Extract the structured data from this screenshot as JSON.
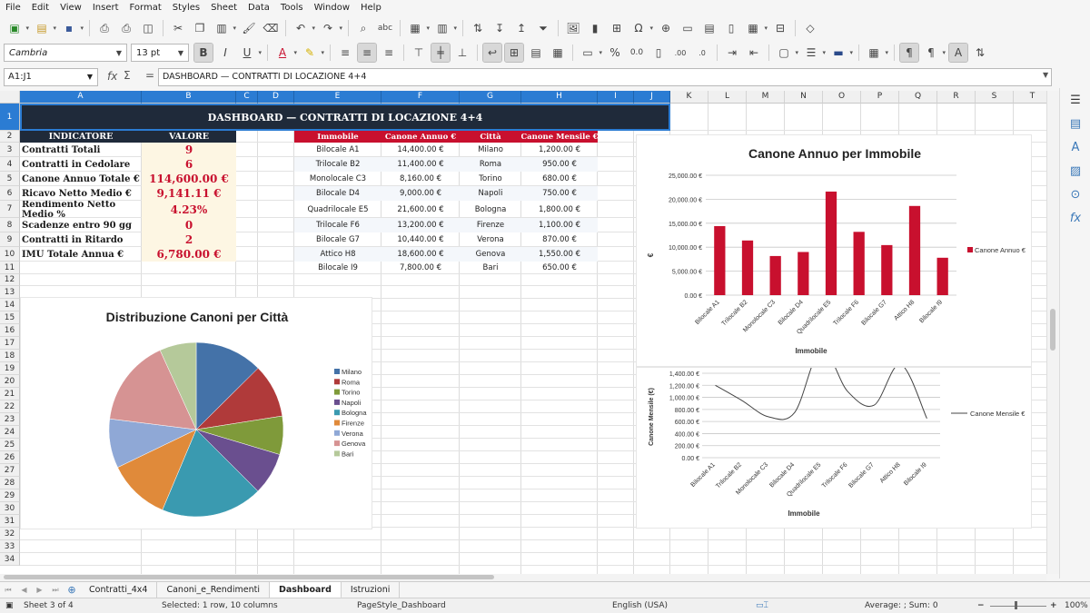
{
  "menu": [
    "File",
    "Edit",
    "View",
    "Insert",
    "Format",
    "Styles",
    "Sheet",
    "Data",
    "Tools",
    "Window",
    "Help"
  ],
  "toolbar": {
    "font_name": "Cambria",
    "font_size": "13 pt"
  },
  "formula_bar": {
    "name_box": "A1:J1",
    "content": "DASHBOARD — CONTRATTI DI LOCAZIONE 4+4"
  },
  "columns": [
    "A",
    "B",
    "C",
    "D",
    "E",
    "F",
    "G",
    "H",
    "I",
    "J",
    "K",
    "L",
    "M",
    "N",
    "O",
    "P",
    "Q",
    "R",
    "S",
    "T"
  ],
  "rows": [
    "1",
    "2",
    "3",
    "4",
    "5",
    "6",
    "7",
    "8",
    "9",
    "10",
    "11",
    "12",
    "13",
    "14",
    "15",
    "16",
    "17",
    "18",
    "19",
    "20",
    "21",
    "22",
    "23",
    "24",
    "25",
    "26",
    "27",
    "28",
    "29",
    "30",
    "31",
    "32",
    "33",
    "34"
  ],
  "banner": "DASHBOARD — CONTRATTI DI LOCAZIONE 4+4",
  "kpi": {
    "header_label": "INDICATORE",
    "header_value": "VALORE",
    "items": [
      {
        "label": "Contratti Totali",
        "value": "9"
      },
      {
        "label": "Contratti in Cedolare",
        "value": "6"
      },
      {
        "label": "Canone Annuo Totale €",
        "value": "114,600.00 €"
      },
      {
        "label": "Ricavo Netto Medio €",
        "value": "9,141.11 €"
      },
      {
        "label": "Rendimento Netto Medio %",
        "value": "4.23%"
      },
      {
        "label": "Scadenze entro 90 gg",
        "value": "0"
      },
      {
        "label": "Contratti in Ritardo",
        "value": "2"
      },
      {
        "label": "IMU Totale Annua €",
        "value": "6,780.00 €"
      }
    ]
  },
  "table": {
    "headers": [
      "Immobile",
      "Canone Annuo €",
      "Città",
      "Canone Mensile €"
    ],
    "rows": [
      [
        "Bilocale A1",
        "14,400.00 €",
        "Milano",
        "1,200.00 €"
      ],
      [
        "Trilocale B2",
        "11,400.00 €",
        "Roma",
        "950.00 €"
      ],
      [
        "Monolocale C3",
        "8,160.00 €",
        "Torino",
        "680.00 €"
      ],
      [
        "Bilocale D4",
        "9,000.00 €",
        "Napoli",
        "750.00 €"
      ],
      [
        "Quadrilocale E5",
        "21,600.00 €",
        "Bologna",
        "1,800.00 €"
      ],
      [
        "Trilocale F6",
        "13,200.00 €",
        "Firenze",
        "1,100.00 €"
      ],
      [
        "Bilocale G7",
        "10,440.00 €",
        "Verona",
        "870.00 €"
      ],
      [
        "Attico H8",
        "18,600.00 €",
        "Genova",
        "1,550.00 €"
      ],
      [
        "Bilocale I9",
        "7,800.00 €",
        "Bari",
        "650.00 €"
      ]
    ]
  },
  "chart_data": [
    {
      "type": "pie",
      "title": "Distribuzione Canoni per Città",
      "categories": [
        "Milano",
        "Roma",
        "Torino",
        "Napoli",
        "Bologna",
        "Firenze",
        "Verona",
        "Genova",
        "Bari"
      ],
      "values": [
        14400,
        11400,
        8160,
        9000,
        21600,
        13200,
        10440,
        18600,
        7800
      ],
      "colors": [
        "#4472a8",
        "#b03a3a",
        "#7f9a3a",
        "#6a4f8f",
        "#3a9ab0",
        "#e08a3a",
        "#8fa8d6",
        "#d69393",
        "#b5c99a"
      ],
      "legend": "right"
    },
    {
      "type": "bar",
      "title": "Canone Annuo per Immobile",
      "categories": [
        "Bilocale A1",
        "Trilocale B2",
        "Monolocale C3",
        "Bilocale D4",
        "Quadrilocale E5",
        "Trilocale F6",
        "Bilocale G7",
        "Attico H8",
        "Bilocale I9"
      ],
      "series": [
        {
          "name": "Canone Annuo €",
          "values": [
            14400,
            11400,
            8160,
            9000,
            21600,
            13200,
            10440,
            18600,
            7800
          ],
          "color": "#c8102e"
        }
      ],
      "xlabel": "Immobile",
      "ylabel": "€",
      "ylim": [
        0,
        25000
      ],
      "yticks": [
        "0.00 €",
        "5,000.00 €",
        "10,000.00 €",
        "15,000.00 €",
        "20,000.00 €",
        "25,000.00 €"
      ],
      "grid": true,
      "legend": "right"
    },
    {
      "type": "line",
      "title": "",
      "categories": [
        "Bilocale A1",
        "Trilocale B2",
        "Monolocale C3",
        "Bilocale D4",
        "Quadrilocale E5",
        "Trilocale F6",
        "Bilocale G7",
        "Attico H8",
        "Bilocale I9"
      ],
      "series": [
        {
          "name": "Canone Mensile €",
          "values": [
            1200,
            950,
            680,
            750,
            1800,
            1100,
            870,
            1550,
            650
          ],
          "color": "#444444"
        }
      ],
      "xlabel": "Immobile",
      "ylabel": "Canone Mensile (€)",
      "ylim": [
        0,
        1400
      ],
      "yticks": [
        "0.00 €",
        "200.00 €",
        "400.00 €",
        "600.00 €",
        "800.00 €",
        "1,000.00 €",
        "1,200.00 €",
        "1,400.00 €"
      ],
      "grid": true,
      "legend": "right"
    }
  ],
  "sheet_tabs": [
    "Contratti_4x4",
    "Canoni_e_Rendimenti",
    "Dashboard",
    "Istruzioni"
  ],
  "active_tab": "Dashboard",
  "status": {
    "sheet": "Sheet 3 of 4",
    "selection": "Selected: 1 row, 10 columns",
    "page_style": "PageStyle_Dashboard",
    "language": "English (USA)",
    "sum": "Average: ; Sum: 0",
    "zoom": "100%"
  }
}
